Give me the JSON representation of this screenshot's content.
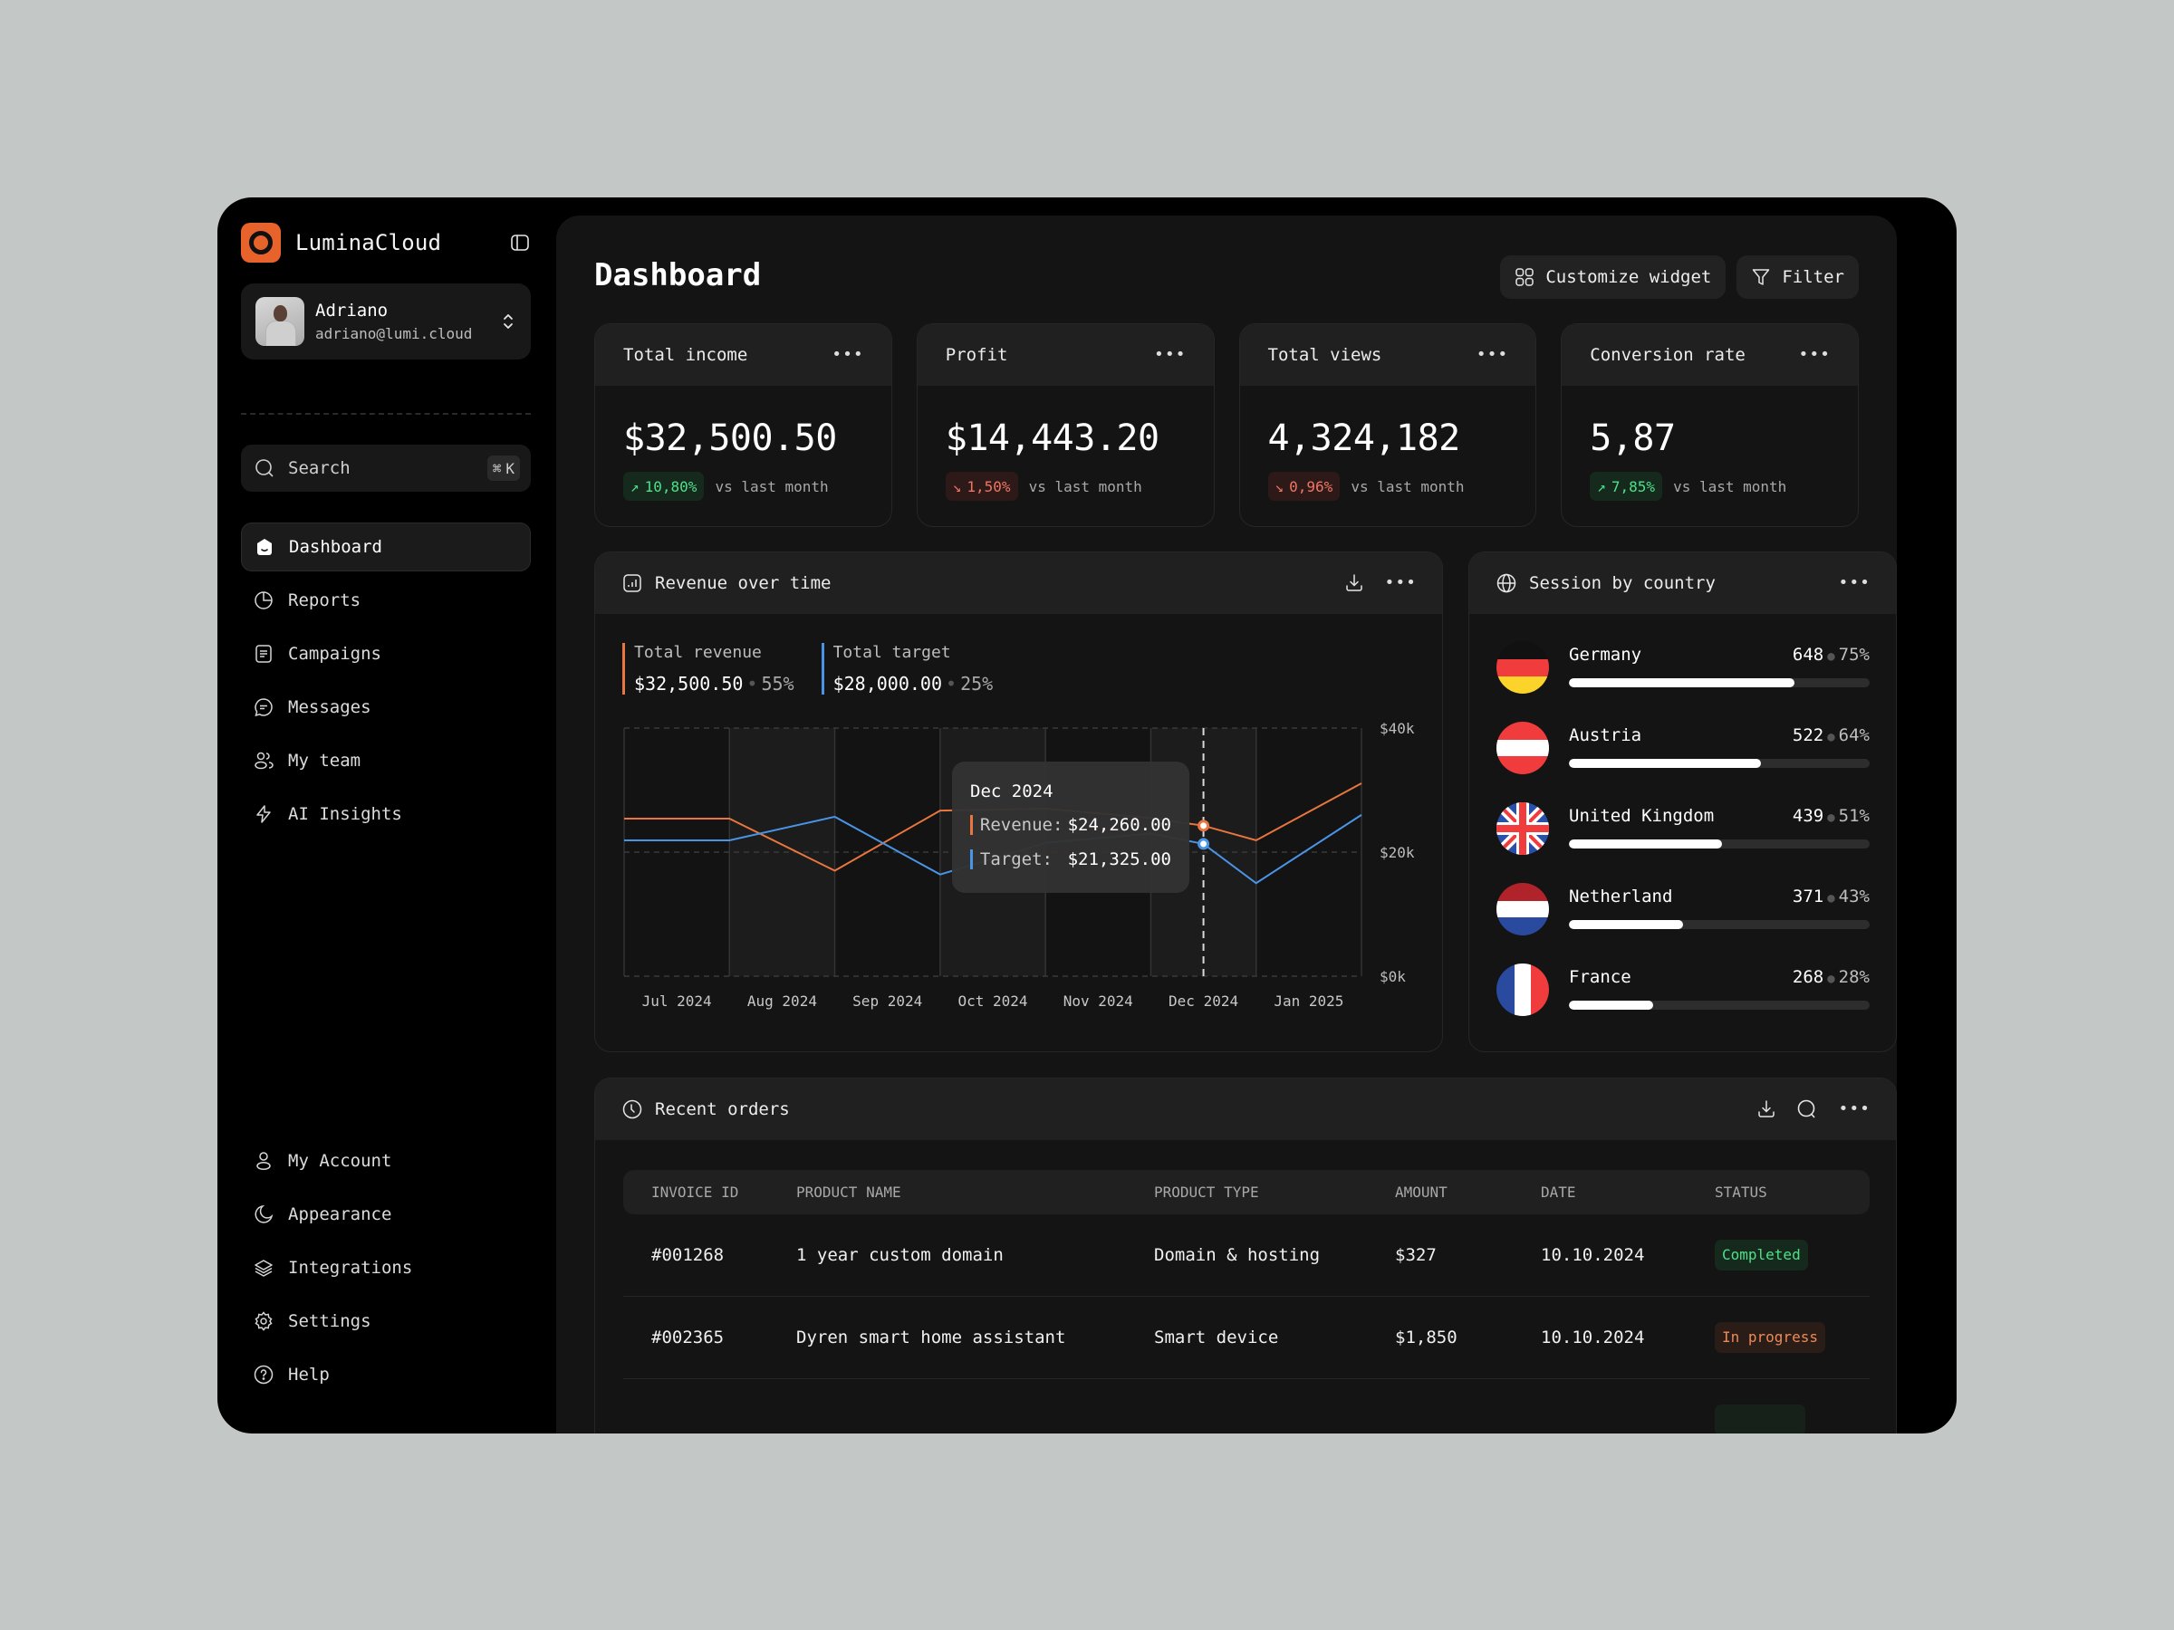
{
  "app": {
    "name": "LuminaCloud",
    "accent": "#e8622c"
  },
  "user": {
    "name": "Adriano",
    "email": "adriano@lumi.cloud"
  },
  "search": {
    "placeholder": "Search",
    "shortcut_symbol": "⌘",
    "shortcut_key": "K"
  },
  "sidebar": {
    "nav": [
      {
        "label": "Dashboard",
        "icon": "home-icon",
        "active": true
      },
      {
        "label": "Reports",
        "icon": "pie-chart-icon"
      },
      {
        "label": "Campaigns",
        "icon": "document-icon"
      },
      {
        "label": "Messages",
        "icon": "chat-bubble-icon"
      },
      {
        "label": "My team",
        "icon": "users-icon"
      },
      {
        "label": "AI Insights",
        "icon": "lightning-icon"
      }
    ],
    "bottom": [
      {
        "label": "My Account",
        "icon": "user-icon"
      },
      {
        "label": "Appearance",
        "icon": "moon-icon"
      },
      {
        "label": "Integrations",
        "icon": "layers-icon"
      },
      {
        "label": "Settings",
        "icon": "gear-icon"
      },
      {
        "label": "Help",
        "icon": "help-circle-icon"
      }
    ]
  },
  "header": {
    "title": "Dashboard",
    "customize_label": "Customize widget",
    "filter_label": "Filter"
  },
  "stats": [
    {
      "title": "Total income",
      "value": "$32,500.50",
      "delta": "10,80%",
      "direction": "up",
      "compare": "vs last month"
    },
    {
      "title": "Profit",
      "value": "$14,443.20",
      "delta": "1,50%",
      "direction": "down",
      "compare": "vs last month"
    },
    {
      "title": "Total views",
      "value": "4,324,182",
      "delta": "0,96%",
      "direction": "down",
      "compare": "vs last month"
    },
    {
      "title": "Conversion rate",
      "value": "5,87",
      "delta": "7,85%",
      "direction": "up",
      "compare": "vs last month"
    }
  ],
  "revenue_panel": {
    "title": "Revenue over time",
    "legend": [
      {
        "label": "Total revenue",
        "value": "$32,500.50",
        "pct": "55%",
        "color": "#e8763e"
      },
      {
        "label": "Total target",
        "value": "$28,000.00",
        "pct": "25%",
        "color": "#4a94e6"
      }
    ],
    "tooltip": {
      "title": "Dec 2024",
      "rows": [
        {
          "key": "Revenue:",
          "value": "$24,260.00",
          "color": "#e8763e"
        },
        {
          "key": "Target:",
          "value": "$21,325.00",
          "color": "#4a94e6"
        }
      ]
    }
  },
  "chart_data": {
    "type": "line",
    "title": "Revenue over time",
    "categories": [
      "Jul 2024",
      "Aug 2024",
      "Sep 2024",
      "Oct 2024",
      "Nov 2024",
      "Dec 2024",
      "Jan 2025"
    ],
    "x": [
      0,
      1,
      2,
      3,
      4,
      5,
      5.5,
      6,
      7
    ],
    "series": [
      {
        "name": "Revenue",
        "color": "#e8763e",
        "values": [
          25400,
          25400,
          17000,
          26700,
          27000,
          25500,
          24260,
          21900,
          31100
        ]
      },
      {
        "name": "Target",
        "color": "#4a94e6",
        "values": [
          21900,
          21900,
          25700,
          16400,
          21500,
          23000,
          21325,
          15000,
          26000
        ]
      }
    ],
    "yticks": [
      "$0k",
      "$20k",
      "$40k"
    ],
    "ylim": [
      0,
      40000
    ],
    "highlight": {
      "category": "Dec 2024",
      "x": 5.5
    },
    "grid": true,
    "ylabel_position": "right"
  },
  "session_panel": {
    "title": "Session by country",
    "countries": [
      {
        "name": "Germany",
        "count": "648",
        "pct": "75%",
        "fraction": 0.75,
        "flag": "de"
      },
      {
        "name": "Austria",
        "count": "522",
        "pct": "64%",
        "fraction": 0.64,
        "flag": "at"
      },
      {
        "name": "United Kingdom",
        "count": "439",
        "pct": "51%",
        "fraction": 0.51,
        "flag": "gb"
      },
      {
        "name": "Netherland",
        "count": "371",
        "pct": "43%",
        "fraction": 0.38,
        "flag": "nl"
      },
      {
        "name": "France",
        "count": "268",
        "pct": "28%",
        "fraction": 0.28,
        "flag": "fr"
      }
    ]
  },
  "orders_panel": {
    "title": "Recent orders",
    "columns": [
      "INVOICE ID",
      "PRODUCT NAME",
      "PRODUCT TYPE",
      "AMOUNT",
      "DATE",
      "STATUS"
    ],
    "rows": [
      {
        "id": "#001268",
        "name": "1 year custom domain",
        "type": "Domain & hosting",
        "amount": "$327",
        "date": "10.10.2024",
        "status": "Completed",
        "status_kind": "done"
      },
      {
        "id": "#002365",
        "name": "Dyren smart home assistant",
        "type": "Smart device",
        "amount": "$1,850",
        "date": "10.10.2024",
        "status": "In progress",
        "status_kind": "prog"
      }
    ]
  }
}
